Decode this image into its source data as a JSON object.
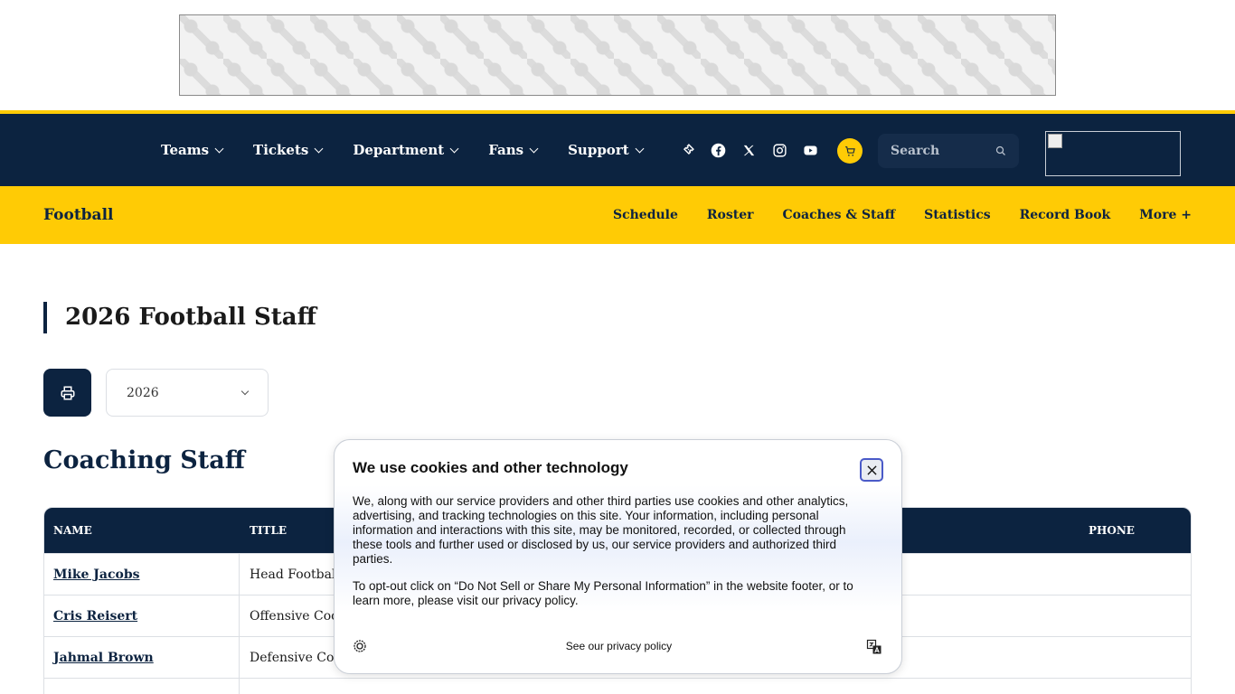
{
  "topnav": {
    "items": [
      {
        "label": "Teams"
      },
      {
        "label": "Tickets"
      },
      {
        "label": "Department"
      },
      {
        "label": "Fans"
      },
      {
        "label": "Support"
      }
    ],
    "social_icons": [
      "ticket-icon",
      "facebook-icon",
      "x-twitter-icon",
      "instagram-icon",
      "youtube-icon"
    ],
    "cart_icon": "cart-icon",
    "search_label": "Search"
  },
  "subnav": {
    "sport": "Football",
    "links": [
      "Schedule",
      "Roster",
      "Coaches & Staff",
      "Statistics",
      "Record Book",
      "More +"
    ]
  },
  "main": {
    "page_title": "2026 Football Staff",
    "season_value": "2026",
    "section_title": "Coaching Staff",
    "table": {
      "headers": {
        "name": "NAME",
        "title": "TITLE",
        "phone": "PHONE"
      },
      "rows": [
        {
          "name": "Mike Jacobs",
          "title": "Head Football C"
        },
        {
          "name": "Cris Reisert",
          "title": "Offensive Coord"
        },
        {
          "name": "Jahmal Brown",
          "title": "Defensive Coord"
        }
      ]
    }
  },
  "cookie": {
    "title": "We use cookies and other technology",
    "p1": "We, along with our service providers and other third parties use cookies and other analytics, advertising, and tracking technologies on this site. Your information, including personal information and interactions with this site, may be monitored, recorded, or collected through these tools and further used or disclosed by us, our service providers and authorized third parties.",
    "p2": "To opt-out click on “Do Not Sell or Share My Personal Information” in the website footer, or to learn more, please visit our privacy policy.",
    "policy_link": "See our privacy policy"
  },
  "colors": {
    "navy": "#0c2340",
    "maize": "#ffcb05"
  }
}
